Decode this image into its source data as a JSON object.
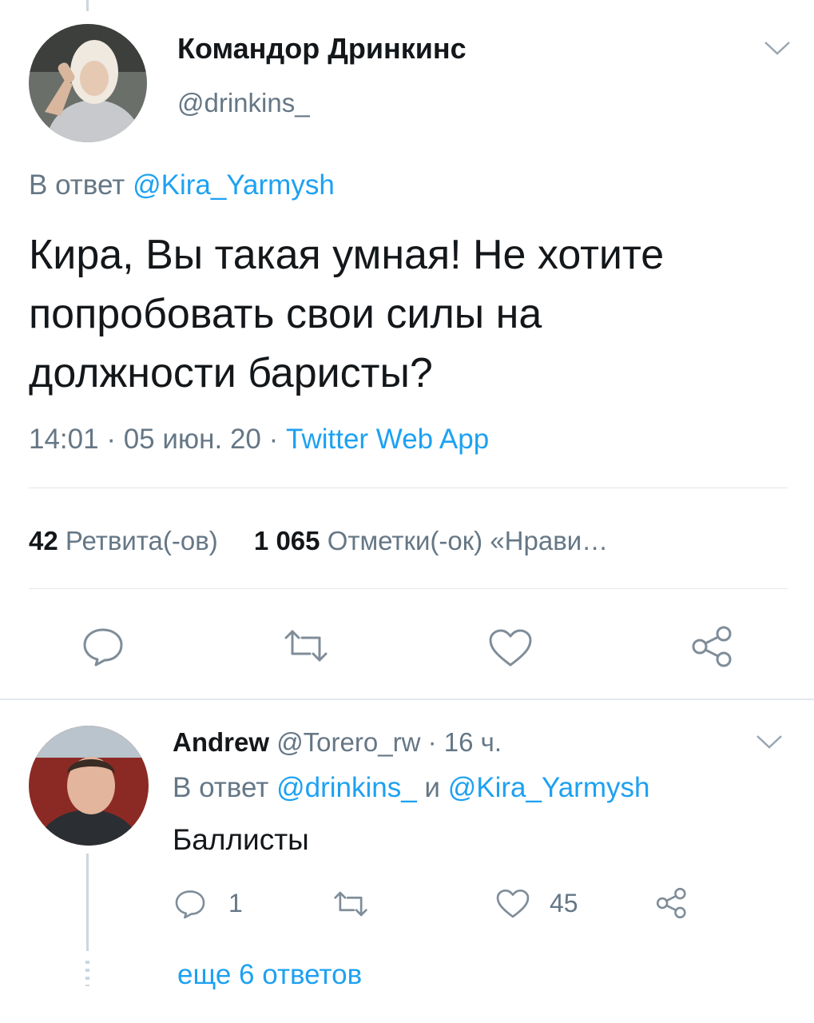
{
  "main_tweet": {
    "author_name": "Командор Дринкинс",
    "author_handle": "@drinkins_",
    "reply_prefix": "В ответ",
    "reply_to": "@Kira_Yarmysh",
    "text_lines": [
      "Кира, Вы такая умная! Не хотите",
      "попробовать свои силы на",
      "должности баристы?"
    ],
    "time": "14:01",
    "date": "05 июн. 20",
    "separator": "·",
    "source": "Twitter Web App",
    "retweets_count": "42",
    "retweets_label": "Ретвита(-ов)",
    "likes_count": "1 065",
    "likes_label": "Отметки(-ок) «Нрави…"
  },
  "reply_tweet": {
    "author_name": "Andrew",
    "author_handle": "@Torero_rw",
    "separator": "·",
    "time_ago": "16 ч.",
    "reply_prefix": "В ответ",
    "reply_to_1": "@drinkins_",
    "reply_and": "и",
    "reply_to_2": "@Kira_Yarmysh",
    "text": "Баллисты",
    "reply_count": "1",
    "like_count": "45"
  },
  "more_replies": "еще 6 ответов",
  "icons": [
    "chevron-down-icon",
    "reply-icon",
    "retweet-icon",
    "heart-icon",
    "share-icon"
  ],
  "colors": {
    "accent": "#1da1f2",
    "muted": "#657786",
    "text": "#14171a",
    "divider": "#e1e8ed"
  }
}
